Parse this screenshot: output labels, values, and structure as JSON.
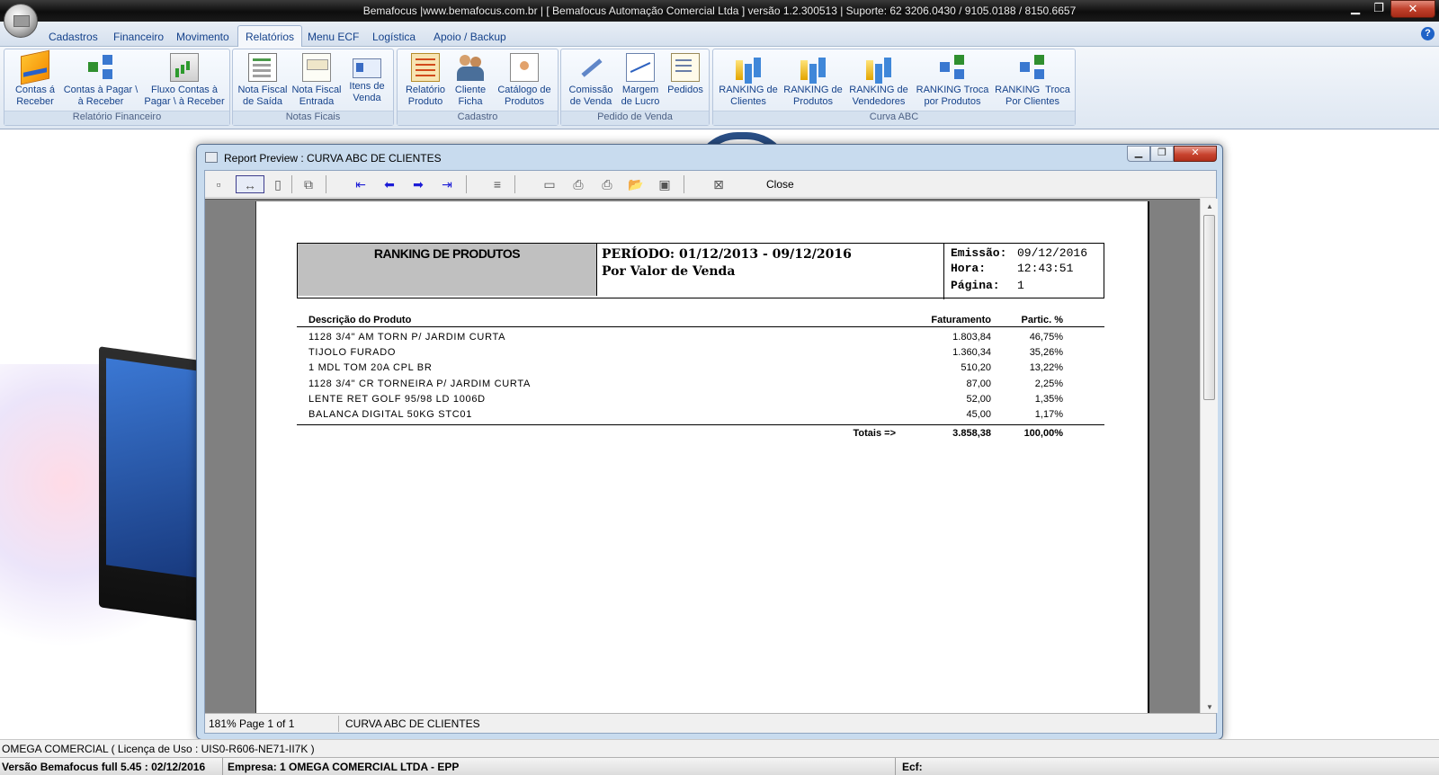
{
  "window": {
    "title": "Bemafocus |www.bemafocus.com.br | [ Bemafocus Automação Comercial Ltda ] versão 1.2.300513 | Suporte: 62 3206.0430 / 9105.0188 / 8150.6657",
    "controls": {
      "minimize": "▁",
      "maximize": "❐",
      "close": "✕"
    }
  },
  "ribbon": {
    "tabs": [
      {
        "label": "Cadastros",
        "active": false
      },
      {
        "label": "Financeiro",
        "active": false
      },
      {
        "label": "Movimento",
        "active": false
      },
      {
        "label": "Relatórios",
        "active": true
      },
      {
        "label": "Menu ECF",
        "active": false
      },
      {
        "label": "Logística",
        "active": false
      },
      {
        "label": "Apoio / Backup",
        "active": false
      }
    ],
    "help": "?",
    "groups": {
      "financeiro": {
        "label": "Relatório Financeiro",
        "buttons": [
          {
            "label": "Contas á\nReceber",
            "icon": "credit-card-icon"
          },
          {
            "label": "Contas à Pagar \\\nà Receber",
            "icon": "flow-blocks-icon"
          },
          {
            "label": "Fluxo Contas à\nPagar \\ à Receber",
            "icon": "chart-up-icon"
          }
        ]
      },
      "notas": {
        "label": "Notas Ficais",
        "buttons": [
          {
            "label": "Nota Fiscal\nde Saída",
            "icon": "document-icon"
          },
          {
            "label": "Nota Fiscal\nEntrada",
            "icon": "form-icon"
          },
          {
            "label": "Itens de\nVenda",
            "icon": "id-card-icon"
          }
        ]
      },
      "cadastro": {
        "label": "Cadastro",
        "buttons": [
          {
            "label": "Relatório\nProduto",
            "icon": "clipboard-icon"
          },
          {
            "label": "Cliente\nFicha",
            "icon": "people-icon"
          },
          {
            "label": "Catálogo de\nProdutos",
            "icon": "catalog-icon"
          }
        ]
      },
      "pedido": {
        "label": "Pedido de Venda",
        "buttons": [
          {
            "label": "Comissão\nde Venda",
            "icon": "pen-icon"
          },
          {
            "label": "Margem\nde Lucro",
            "icon": "line-chart-icon"
          },
          {
            "label": "Pedidos",
            "icon": "order-icon"
          }
        ]
      },
      "curva": {
        "label": "Curva ABC",
        "buttons": [
          {
            "label": "RANKING de\nClientes",
            "icon": "bar-chart-icon"
          },
          {
            "label": "RANKING de\nProdutos",
            "icon": "bar-chart-icon"
          },
          {
            "label": "RANKING de\nVendedores",
            "icon": "bar-chart-icon"
          },
          {
            "label": "RANKING Troca\npor Produtos",
            "icon": "flow-blocks-icon"
          },
          {
            "label": "RANKING  Troca\nPor Clientes",
            "icon": "flow-blocks-icon"
          }
        ]
      }
    }
  },
  "report_window": {
    "title": "Report Preview : CURVA ABC DE CLIENTES",
    "close_label": "Close",
    "status": {
      "zoom": "181%",
      "page": "Page 1 of 1",
      "report_name": "CURVA ABC DE CLIENTES"
    },
    "report": {
      "title": "RANKING DE PRODUTOS",
      "period_line": "PERÍODO: 01/12/2013 - 09/12/2016",
      "order_line": "Por Valor de Venda",
      "meta": [
        {
          "key": "Emissão:",
          "value": "09/12/2016"
        },
        {
          "key": "Hora:",
          "value": "12:43:51"
        },
        {
          "key": "Página:",
          "value": "1"
        }
      ],
      "columns": [
        "Descrição do Produto",
        "Faturamento",
        "Partic. %"
      ],
      "rows": [
        {
          "desc": "1128 3/4\" AM TORN P/ JARDIM CURTA",
          "fat": "1.803,84",
          "part": "46,75%"
        },
        {
          "desc": "TIJOLO FURADO",
          "fat": "1.360,34",
          "part": "35,26%"
        },
        {
          "desc": "1 MDL TOM 20A CPL BR",
          "fat": "510,20",
          "part": "13,22%"
        },
        {
          "desc": "1128 3/4\" CR TORNEIRA P/ JARDIM CURTA",
          "fat": "87,00",
          "part": "2,25%"
        },
        {
          "desc": "LENTE RET GOLF 95/98 LD 1006D",
          "fat": "52,00",
          "part": "1,35%"
        },
        {
          "desc": "BALANCA DIGITAL 50KG STC01",
          "fat": "45,00",
          "part": "1,17%"
        }
      ],
      "totals": {
        "label": "Totais =>",
        "fat": "3.858,38",
        "part": "100,00%"
      }
    }
  },
  "app_status": {
    "license": "OMEGA COMERCIAL  ( Licença de Uso : UIS0-R606-NE71-II7K  )",
    "version": "Versão Bemafocus full 5.45  : 02/12/2016",
    "company": "Empresa: 1 OMEGA COMERCIAL LTDA - EPP",
    "ecf": "Ecf:"
  }
}
